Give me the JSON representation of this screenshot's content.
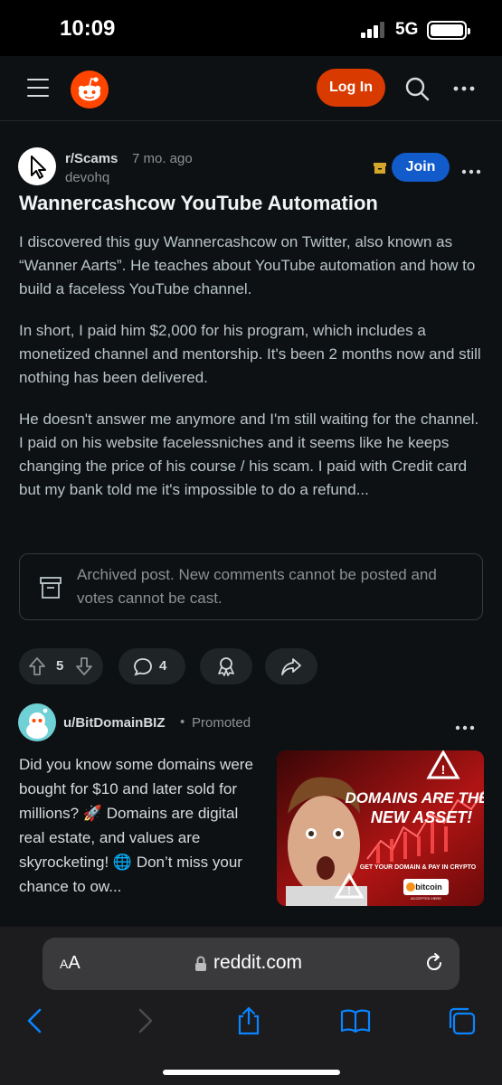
{
  "status_bar": {
    "time": "10:09",
    "network": "5G"
  },
  "header": {
    "login_label": "Log In",
    "icons": [
      "menu-icon",
      "reddit-logo",
      "search-icon",
      "more-icon"
    ]
  },
  "post": {
    "subreddit": "r/Scams",
    "age": "7 mo. ago",
    "author": "devohq",
    "join_label": "Join",
    "title": "Wannercashcow YouTube Automation",
    "paragraphs": [
      "I discovered this guy Wannercashcow on Twitter, also known as “Wanner Aarts”. He teaches about YouTube automation and how to build a faceless YouTube channel.",
      "In short, I paid him $2,000 for his program, which includes a monetized channel and mentorship. It's been 2 months now and still nothing has been delivered.",
      "He doesn't answer me anymore and I'm still waiting for the channel. I paid on his website facelessniches and it seems like he keeps changing the price of his course / his scam. I paid with Credit card but my bank told me it's impossible to do a refund..."
    ],
    "archived_notice": "Archived post. New comments cannot be posted and votes cannot be cast.",
    "score": "5",
    "comments": "4"
  },
  "promoted": {
    "user": "u/BitDomainBIZ",
    "dot": "•",
    "label": "Promoted",
    "text": "Did you know some domains were bought for $10 and later sold for millions? 🚀 Domains are digital real estate, and values are skyrocketing! 🌐 Don’t miss your chance to ow...",
    "image": {
      "headline": "DOMAINS ARE THE NEW ASSET!",
      "subline": "GET YOUR DOMAIN & PAY IN CRYPTO",
      "badge": "bitcoin",
      "badge_sub": "ACCEPTED HERE"
    }
  },
  "browser": {
    "text_size_small": "A",
    "text_size_large": "A",
    "domain": "reddit.com"
  },
  "colors": {
    "accent_orange": "#ff4500",
    "login": "#d93a00",
    "join": "#115bca",
    "background": "#0e1113"
  }
}
